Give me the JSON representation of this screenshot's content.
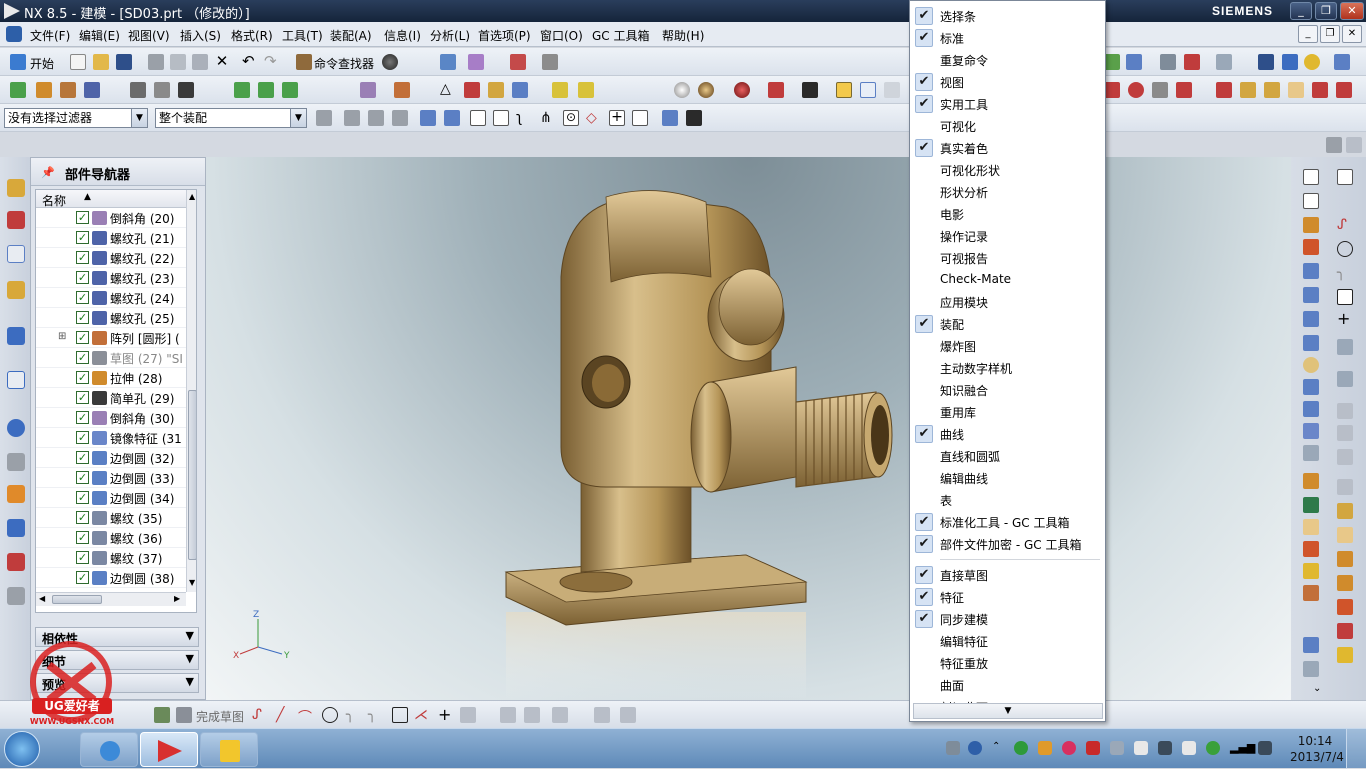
{
  "window": {
    "title": "NX 8.5 - 建模 - [SD03.prt （修改的）]",
    "brand": "SIEMENS",
    "minimize": "_",
    "maximize": "❐",
    "close": "✕"
  },
  "menubar": {
    "items": [
      "文件(F)",
      "编辑(E)",
      "视图(V)",
      "插入(S)",
      "格式(R)",
      "工具(T)",
      "装配(A)",
      "信息(I)",
      "分析(L)",
      "首选项(P)",
      "窗口(O)",
      "GC 工具箱",
      "帮助(H)"
    ]
  },
  "toolbar": {
    "start_label": "开始",
    "cmd_finder_label": "命令查找器"
  },
  "selection_bar": {
    "filter_value": "没有选择过滤器",
    "scope_value": "整个装配"
  },
  "part_navigator": {
    "title": "部件导航器",
    "column_header": "名称",
    "items": [
      {
        "label": "倒斜角 (20)",
        "icon": "chamfer-icon",
        "color": "#9a7fb5",
        "dim": false,
        "expander": false
      },
      {
        "label": "螺纹孔 (21)",
        "icon": "threaded-hole-icon",
        "color": "#4e63a8",
        "dim": false,
        "expander": false
      },
      {
        "label": "螺纹孔 (22)",
        "icon": "threaded-hole-icon",
        "color": "#4e63a8",
        "dim": false,
        "expander": false
      },
      {
        "label": "螺纹孔 (23)",
        "icon": "threaded-hole-icon",
        "color": "#4e63a8",
        "dim": false,
        "expander": false
      },
      {
        "label": "螺纹孔 (24)",
        "icon": "threaded-hole-icon",
        "color": "#4e63a8",
        "dim": false,
        "expander": false
      },
      {
        "label": "螺纹孔 (25)",
        "icon": "threaded-hole-icon",
        "color": "#4e63a8",
        "dim": false,
        "expander": false
      },
      {
        "label": "阵列 [圆形] (",
        "icon": "pattern-icon",
        "color": "#c26f39",
        "dim": false,
        "expander": true
      },
      {
        "label": "草图 (27) \"SI",
        "icon": "sketch-icon",
        "color": "#8b8f98",
        "dim": true,
        "expander": false
      },
      {
        "label": "拉伸 (28)",
        "icon": "extrude-icon",
        "color": "#d08b2c",
        "dim": false,
        "expander": false
      },
      {
        "label": "简单孔 (29)",
        "icon": "simple-hole-icon",
        "color": "#3a3a3a",
        "dim": false,
        "expander": false
      },
      {
        "label": "倒斜角 (30)",
        "icon": "chamfer-icon",
        "color": "#9a7fb5",
        "dim": false,
        "expander": false
      },
      {
        "label": "镜像特征 (31",
        "icon": "mirror-feature-icon",
        "color": "#6a86c9",
        "dim": false,
        "expander": false
      },
      {
        "label": "边倒圆 (32)",
        "icon": "edge-blend-icon",
        "color": "#5a7fc4",
        "dim": false,
        "expander": false
      },
      {
        "label": "边倒圆 (33)",
        "icon": "edge-blend-icon",
        "color": "#5a7fc4",
        "dim": false,
        "expander": false
      },
      {
        "label": "边倒圆 (34)",
        "icon": "edge-blend-icon",
        "color": "#5a7fc4",
        "dim": false,
        "expander": false
      },
      {
        "label": "螺纹 (35)",
        "icon": "thread-icon",
        "color": "#7b88a3",
        "dim": false,
        "expander": false
      },
      {
        "label": "螺纹 (36)",
        "icon": "thread-icon",
        "color": "#7b88a3",
        "dim": false,
        "expander": false
      },
      {
        "label": "螺纹 (37)",
        "icon": "thread-icon",
        "color": "#7b88a3",
        "dim": false,
        "expander": false
      },
      {
        "label": "边倒圆 (38)",
        "icon": "edge-blend-icon",
        "color": "#5a7fc4",
        "dim": false,
        "expander": false
      }
    ],
    "sections": [
      "相依性",
      "细节",
      "预览"
    ]
  },
  "triad": {
    "z": "Z",
    "x": "X",
    "y": "Y"
  },
  "bottom_toolbar": {
    "finish_sketch_label": "完成草图"
  },
  "toolbar_menu": {
    "items": [
      {
        "label": "选择条",
        "checked": true,
        "sep_before": false
      },
      {
        "label": "标准",
        "checked": true,
        "sep_before": false
      },
      {
        "label": "重复命令",
        "checked": false,
        "sep_before": false
      },
      {
        "label": "视图",
        "checked": true,
        "sep_before": false
      },
      {
        "label": "实用工具",
        "checked": true,
        "sep_before": false
      },
      {
        "label": "可视化",
        "checked": false,
        "sep_before": false
      },
      {
        "label": "真实着色",
        "checked": true,
        "sep_before": false
      },
      {
        "label": "可视化形状",
        "checked": false,
        "sep_before": false
      },
      {
        "label": "形状分析",
        "checked": false,
        "sep_before": false
      },
      {
        "label": "电影",
        "checked": false,
        "sep_before": false
      },
      {
        "label": "操作记录",
        "checked": false,
        "sep_before": false
      },
      {
        "label": "可视报告",
        "checked": false,
        "sep_before": false
      },
      {
        "label": "Check-Mate",
        "checked": false,
        "sep_before": false
      },
      {
        "label": "应用模块",
        "checked": false,
        "sep_before": false
      },
      {
        "label": "装配",
        "checked": true,
        "sep_before": false
      },
      {
        "label": "爆炸图",
        "checked": false,
        "sep_before": false
      },
      {
        "label": "主动数字样机",
        "checked": false,
        "sep_before": false
      },
      {
        "label": "知识融合",
        "checked": false,
        "sep_before": false
      },
      {
        "label": "重用库",
        "checked": false,
        "sep_before": false
      },
      {
        "label": "曲线",
        "checked": true,
        "sep_before": false
      },
      {
        "label": "直线和圆弧",
        "checked": false,
        "sep_before": false
      },
      {
        "label": "编辑曲线",
        "checked": false,
        "sep_before": false
      },
      {
        "label": "表",
        "checked": false,
        "sep_before": false
      },
      {
        "label": "标准化工具 - GC 工具箱",
        "checked": true,
        "sep_before": false
      },
      {
        "label": "部件文件加密 - GC 工具箱",
        "checked": true,
        "sep_before": false
      },
      {
        "label": "直接草图",
        "checked": true,
        "sep_before": true
      },
      {
        "label": "特征",
        "checked": true,
        "sep_before": false
      },
      {
        "label": "同步建模",
        "checked": true,
        "sep_before": false
      },
      {
        "label": "编辑特征",
        "checked": false,
        "sep_before": false
      },
      {
        "label": "特征重放",
        "checked": false,
        "sep_before": false
      },
      {
        "label": "曲面",
        "checked": false,
        "sep_before": false
      },
      {
        "label": "剖切曲面",
        "checked": false,
        "sep_before": false
      }
    ],
    "more_arrow": "▼"
  },
  "taskbar": {
    "time": "10:14",
    "date": "2013/7/4"
  },
  "watermark": {
    "brand": "UG爱好者",
    "url": "WWW.UGSNX.COM"
  },
  "colors": {
    "accent": "#2d5fa8",
    "model": "#b89a62",
    "menu_check_bg": "#d6e3f4"
  }
}
